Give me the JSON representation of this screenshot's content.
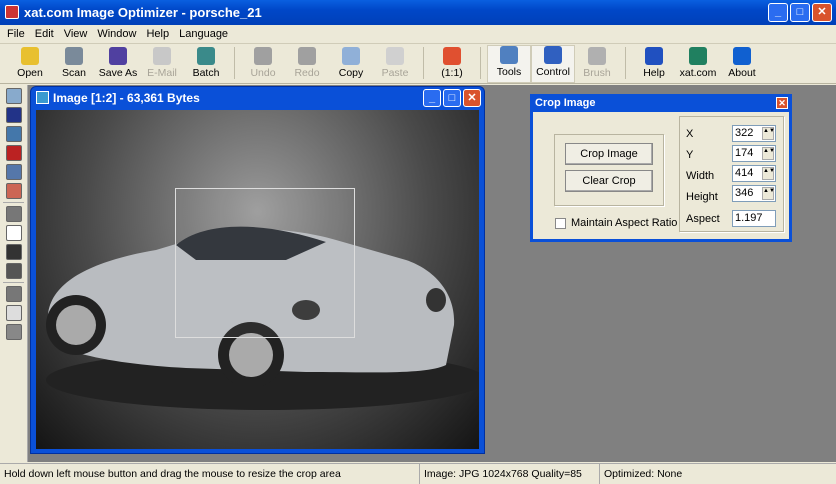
{
  "app": {
    "title": "xat.com  Image Optimizer - porsche_21"
  },
  "menu": [
    "File",
    "Edit",
    "View",
    "Window",
    "Help",
    "Language"
  ],
  "toolbar": [
    {
      "label": "Open",
      "icon": "open-folder-icon",
      "color": "#e8c030",
      "enabled": true
    },
    {
      "label": "Scan",
      "icon": "scanner-icon",
      "color": "#7a8a9a",
      "enabled": true
    },
    {
      "label": "Save As",
      "icon": "floppy-disk-icon",
      "color": "#5040a0",
      "enabled": true
    },
    {
      "label": "E-Mail",
      "icon": "email-icon",
      "color": "#c8c8c8",
      "enabled": false
    },
    {
      "label": "Batch",
      "icon": "batch-icon",
      "color": "#3a8a8a",
      "enabled": true
    },
    {
      "label": "Undo",
      "icon": "undo-icon",
      "color": "#a0a0a0",
      "enabled": false
    },
    {
      "label": "Redo",
      "icon": "redo-icon",
      "color": "#a0a0a0",
      "enabled": false
    },
    {
      "label": "Copy",
      "icon": "copy-icon",
      "color": "#90b0d8",
      "enabled": true
    },
    {
      "label": "Paste",
      "icon": "paste-icon",
      "color": "#d0d0d0",
      "enabled": false
    },
    {
      "label": "(1:1)",
      "icon": "actual-size-icon",
      "color": "#e05030",
      "enabled": true
    },
    {
      "label": "Tools",
      "icon": "hammer-icon",
      "color": "#5080c0",
      "enabled": true
    },
    {
      "label": "Control",
      "icon": "control-icon",
      "color": "#3060c0",
      "enabled": true
    },
    {
      "label": "Brush",
      "icon": "brush-icon",
      "color": "#b0b0b0",
      "enabled": false
    },
    {
      "label": "Help",
      "icon": "help-icon",
      "color": "#2050c0",
      "enabled": true
    },
    {
      "label": "xat.com",
      "icon": "globe-icon",
      "color": "#208060",
      "enabled": true
    },
    {
      "label": "About",
      "icon": "info-icon",
      "color": "#1060d0",
      "enabled": true
    }
  ],
  "tools": [
    "magnifier",
    "crop",
    "resize",
    "text",
    "stamp",
    "effects",
    "lasso",
    "rectangle",
    "line",
    "dropper",
    "fill-color",
    "frame",
    "border"
  ],
  "image_window": {
    "title": "Image [1:2] - 63,361 Bytes"
  },
  "crop_dialog": {
    "title": "Crop Image",
    "crop_button": "Crop Image",
    "clear_button": "Clear Crop",
    "maintain_aspect": "Maintain Aspect Ratio",
    "maintain_checked": false,
    "fields": [
      {
        "label": "X",
        "value": "322"
      },
      {
        "label": "Y",
        "value": "174"
      },
      {
        "label": "Width",
        "value": "414"
      },
      {
        "label": "Height",
        "value": "346"
      }
    ],
    "aspect_label": "Aspect",
    "aspect_value": "1.197"
  },
  "status": {
    "hint": "Hold down left mouse button and drag the mouse to resize the crop area",
    "image": "Image: JPG 1024x768  Quality=85",
    "optimized": "Optimized: None"
  }
}
